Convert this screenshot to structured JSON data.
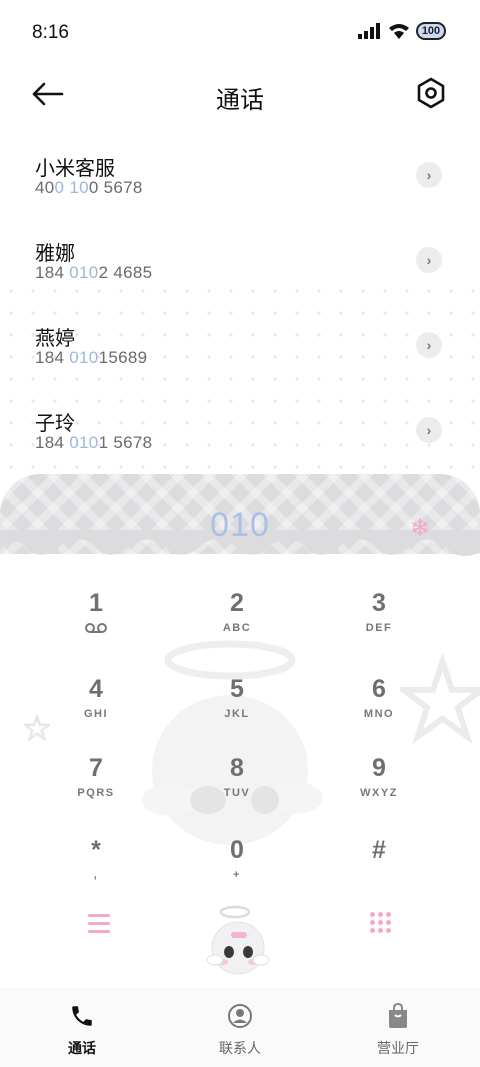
{
  "status": {
    "time": "8:16",
    "battery": "100"
  },
  "header": {
    "title": "通话"
  },
  "contacts": [
    {
      "name": "小米客服",
      "number_parts": [
        "40",
        "0",
        " ",
        "10",
        "0 5678"
      ]
    },
    {
      "name": "雅娜",
      "number_parts": [
        "184 ",
        "010",
        "2 4685",
        "",
        ""
      ]
    },
    {
      "name": "燕婷",
      "number_parts": [
        "184 ",
        "010",
        "15689",
        "",
        ""
      ]
    },
    {
      "name": "子玲",
      "number_parts": [
        "184 ",
        "010",
        "1 5678",
        "",
        ""
      ]
    }
  ],
  "dialer": {
    "display": "010"
  },
  "keys": [
    {
      "digit": "1",
      "letters": ""
    },
    {
      "digit": "2",
      "letters": "ABC"
    },
    {
      "digit": "3",
      "letters": "DEF"
    },
    {
      "digit": "4",
      "letters": "GHI"
    },
    {
      "digit": "5",
      "letters": "JKL"
    },
    {
      "digit": "6",
      "letters": "MNO"
    },
    {
      "digit": "7",
      "letters": "PQRS"
    },
    {
      "digit": "8",
      "letters": "TUV"
    },
    {
      "digit": "9",
      "letters": "WXYZ"
    },
    {
      "digit": "*",
      "letters": ","
    },
    {
      "digit": "0",
      "letters": "+"
    },
    {
      "digit": "#",
      "letters": ""
    }
  ],
  "tabs": [
    {
      "label": "通话",
      "icon": "phone-icon",
      "active": true
    },
    {
      "label": "联系人",
      "icon": "contacts-icon",
      "active": false
    },
    {
      "label": "营业厅",
      "icon": "shop-bag-icon",
      "active": false
    }
  ],
  "colors": {
    "highlight": "#9fb6de",
    "accent_pink": "#f2a9c8",
    "display": "#a9c1e6"
  }
}
